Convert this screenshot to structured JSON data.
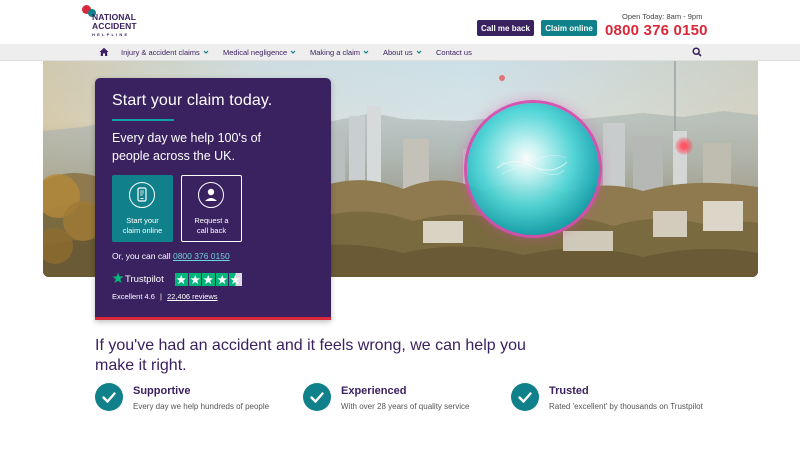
{
  "brand": {
    "line1": "NATIONAL",
    "line2": "ACCIDENT",
    "line3": "HELPLINE",
    "colors": {
      "purple": "#3a2160",
      "teal": "#10818a",
      "red": "#d8283a"
    }
  },
  "header": {
    "call_me_back": "Call me back",
    "claim_online": "Claim online",
    "hours": "Open Today: 8am - 9pm",
    "phone": "0800 376 0150"
  },
  "nav": {
    "home_icon": "home-icon",
    "items": [
      {
        "label": "Injury & accident claims",
        "has_dropdown": true
      },
      {
        "label": "Medical negligence",
        "has_dropdown": true
      },
      {
        "label": "Making a claim",
        "has_dropdown": true
      },
      {
        "label": "About us",
        "has_dropdown": true
      },
      {
        "label": "Contact us",
        "has_dropdown": false
      }
    ],
    "search_icon": "search-icon"
  },
  "card": {
    "title": "Start your claim today.",
    "intro_line1": "Every day we help 100's of",
    "intro_line2": "people across the UK.",
    "tile_online": {
      "line1": "Start your",
      "line2": "claim online",
      "icon": "mobile-phone-icon"
    },
    "tile_call": {
      "line1": "Request a",
      "line2": "call back",
      "icon": "person-icon"
    },
    "call_prefix": "Or, you can call",
    "call_number": "0800 376 0150",
    "trustpilot": {
      "name": "Trustpilot",
      "stars": 4.5,
      "rating_text": "Excellent 4.6",
      "separator": "|",
      "reviews": "22,406 reviews"
    }
  },
  "main": {
    "headline": "If you've had an accident and it feels wrong, we can help you make it right.",
    "features": [
      {
        "title": "Supportive",
        "desc": "Every day we help hundreds of people",
        "icon": "check-icon"
      },
      {
        "title": "Experienced",
        "desc": "With over 28 years of quality service",
        "icon": "check-icon"
      },
      {
        "title": "Trusted",
        "desc": "Rated 'excellent' by thousands on Trustpilot",
        "icon": "check-icon"
      }
    ]
  }
}
